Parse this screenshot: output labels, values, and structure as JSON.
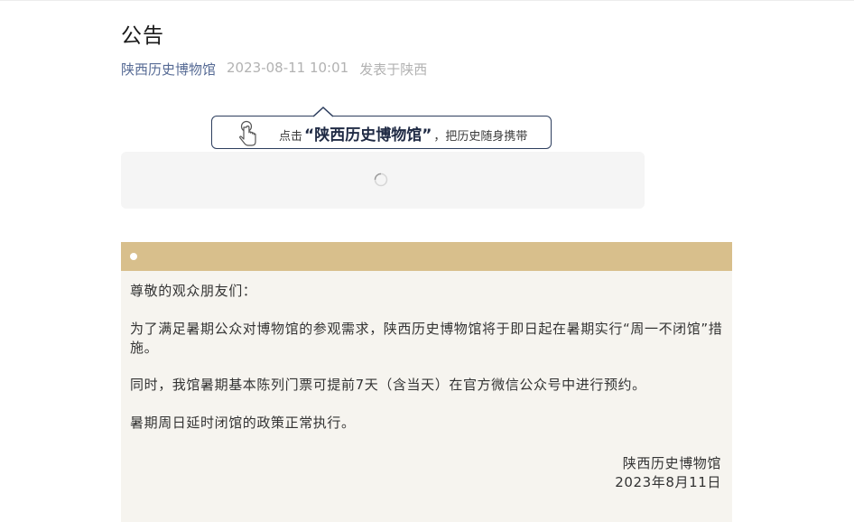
{
  "article": {
    "title": "公告",
    "author": "陕西历史博物馆",
    "date": "2023-08-11 10:01",
    "location": "发表于陕西"
  },
  "follow_card": {
    "prefix": "点击",
    "name": "“陕西历史博物馆”",
    "suffix": "，把历史随身携带",
    "icon": "tap-hand-icon"
  },
  "loading": {
    "icon": "loading-spinner-icon"
  },
  "notice": {
    "header_color": "#d8bf8c",
    "greeting": "尊敬的观众朋友们：",
    "paragraph1": "为了满足暑期公众对博物馆的参观需求，陕西历史博物馆将于即日起在暑期实行“周一不闭馆”措施。",
    "paragraph2": "同时，我馆暑期基本陈列门票可提前7天（含当天）在官方微信公众号中进行预约。",
    "paragraph3": "暑期周日延时闭馆的政策正常执行。",
    "signature": "陕西历史博物馆",
    "sign_date": "2023年8月11日"
  }
}
